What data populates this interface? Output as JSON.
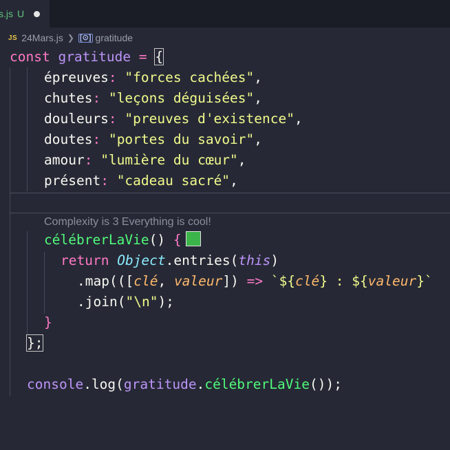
{
  "tab": {
    "filename": "s.js",
    "status": "U"
  },
  "breadcrumb": {
    "file_badge": "JS",
    "file": "24Mars.js",
    "symbol_badge": "[⊙]",
    "symbol": "gratitude"
  },
  "codelens": {
    "text": "Complexity is 3 Everything is cool!"
  },
  "code": {
    "l1": {
      "kw": "const",
      "name": "gratitude",
      "eq": "=",
      "brace": "{"
    },
    "props": [
      {
        "key": "épreuves",
        "value": "\"forces cachées\""
      },
      {
        "key": "chutes",
        "value": "\"leçons déguisées\""
      },
      {
        "key": "douleurs",
        "value": "\"preuves d'existence\""
      },
      {
        "key": "doutes",
        "value": "\"portes du savoir\""
      },
      {
        "key": "amour",
        "value": "\"lumière du cœur\""
      },
      {
        "key": "présent",
        "value": "\"cadeau sacré\""
      }
    ],
    "method": {
      "name": "célébrerLaVie",
      "parens": "()",
      "brace": "{"
    },
    "ret": {
      "kw": "return",
      "cls": "Object",
      "dot": ".",
      "fn": "entries",
      "lp": "(",
      "this": "this",
      "rp": ")"
    },
    "map": {
      "dot": ".",
      "fn": "map",
      "open": "(([",
      "p1": "clé",
      "comma": ", ",
      "p2": "valeur",
      "close": "])",
      "arrow": " => ",
      "tpl1": "`${",
      "tp1": "clé",
      "tpl2": "} : ${",
      "tp2": "valeur",
      "tpl3": "}`"
    },
    "join": {
      "dot": ".",
      "fn": "join",
      "lp": "(",
      "arg": "\"\\n\"",
      "rp": ");"
    },
    "close_method": "}",
    "close_obj": "};",
    "console": {
      "obj": "console",
      "dot1": ".",
      "fn": "log",
      "lp": "(",
      "target": "gratitude",
      "dot2": ".",
      "call": "célébrerLaVie",
      "rest": "());"
    }
  }
}
